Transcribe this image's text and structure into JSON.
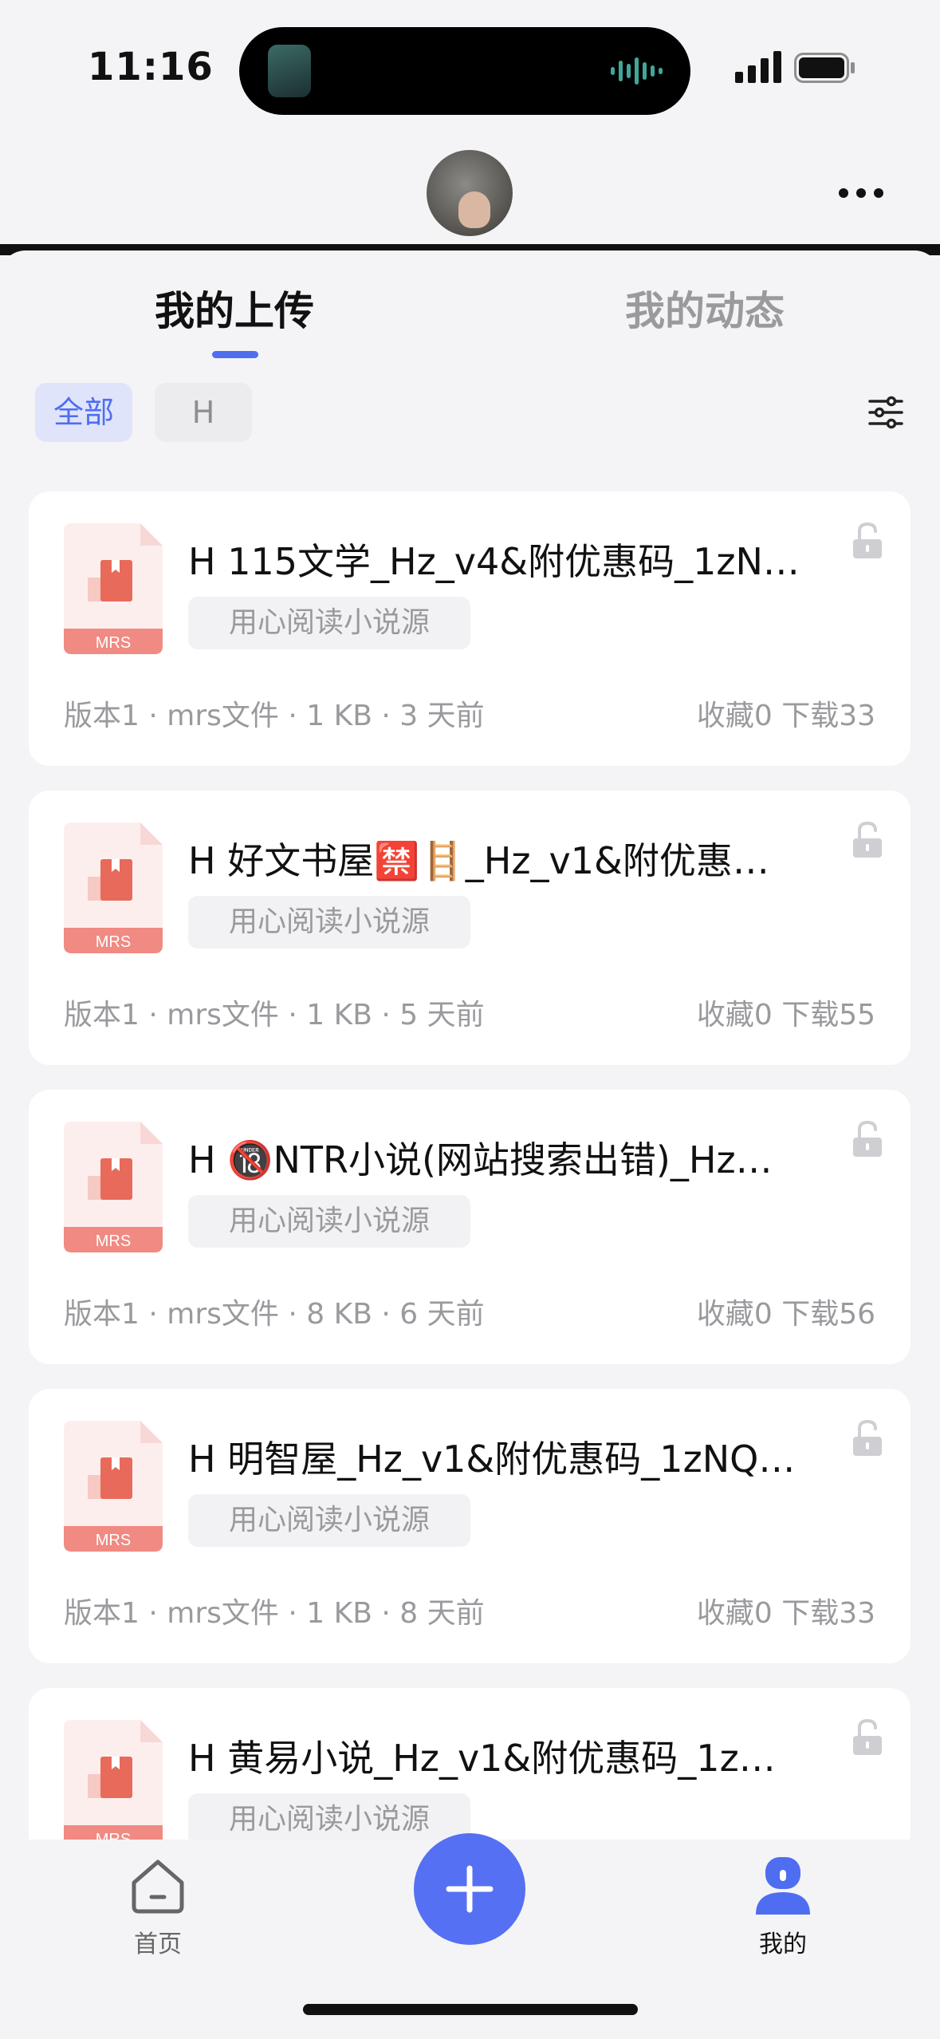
{
  "status_bar": {
    "time": "11:16"
  },
  "tabs": [
    {
      "label": "我的上传"
    },
    {
      "label": "我的动态"
    }
  ],
  "filters": [
    {
      "label": "全部",
      "selected": true
    },
    {
      "label": "H",
      "selected": false
    }
  ],
  "files": [
    {
      "icon_label": "MRS",
      "title": "H 115文学_Hz_v4&附优惠码_1zN…",
      "tag": "用心阅读小说源",
      "version": "版本1",
      "type": "mrs文件",
      "size": "1 KB",
      "time": "3 天前",
      "favorites": "收藏0",
      "downloads": "下载33"
    },
    {
      "icon_label": "MRS",
      "title": "H 好文书屋🈲🪜_Hz_v1&附优惠…",
      "tag": "用心阅读小说源",
      "version": "版本1",
      "type": "mrs文件",
      "size": "1 KB",
      "time": "5 天前",
      "favorites": "收藏0",
      "downloads": "下载55"
    },
    {
      "icon_label": "MRS",
      "title": "H 🔞NTR小说(网站搜索出错)_Hz…",
      "tag": "用心阅读小说源",
      "version": "版本1",
      "type": "mrs文件",
      "size": "8 KB",
      "time": "6 天前",
      "favorites": "收藏0",
      "downloads": "下载56"
    },
    {
      "icon_label": "MRS",
      "title": "H 明智屋_Hz_v1&附优惠码_1zNQ…",
      "tag": "用心阅读小说源",
      "version": "版本1",
      "type": "mrs文件",
      "size": "1 KB",
      "time": "8 天前",
      "favorites": "收藏0",
      "downloads": "下载33"
    },
    {
      "icon_label": "MRS",
      "title": "H 黄易小说_Hz_v1&附优惠码_1z…",
      "tag": "用心阅读小说源",
      "version": "",
      "type": "",
      "size": "",
      "time": "",
      "favorites": "",
      "downloads": ""
    }
  ],
  "bottom_nav": {
    "home_label": "首页",
    "mine_label": "我的"
  },
  "colors": {
    "accent": "#4f6df0",
    "file_icon": "#e86a5a"
  }
}
